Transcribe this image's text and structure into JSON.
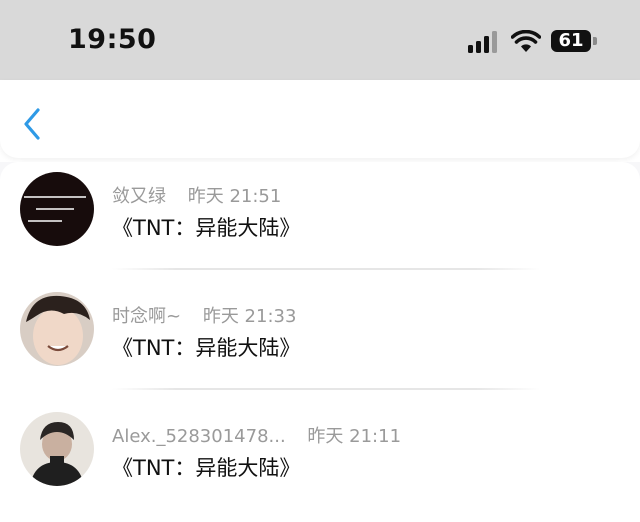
{
  "status_bar": {
    "time": "19:50",
    "battery_level": "61",
    "icons": [
      "signal-icon",
      "wifi-icon",
      "battery-icon"
    ]
  },
  "nav": {
    "back_icon": "chevron-left-icon",
    "accent_color": "#2f9ae6"
  },
  "items": [
    {
      "name": "敛又绿",
      "time": "昨天 21:51",
      "content": "《TNT：异能大陆》",
      "avatar": "dark-text-avatar"
    },
    {
      "name": "时念啊~",
      "time": "昨天 21:33",
      "content": "《TNT：异能大陆》",
      "avatar": "smiling-person-avatar"
    },
    {
      "name": "Alex._528301478...",
      "time": "昨天 21:11",
      "content": "《TNT：异能大陆》",
      "avatar": "person-avatar"
    }
  ]
}
